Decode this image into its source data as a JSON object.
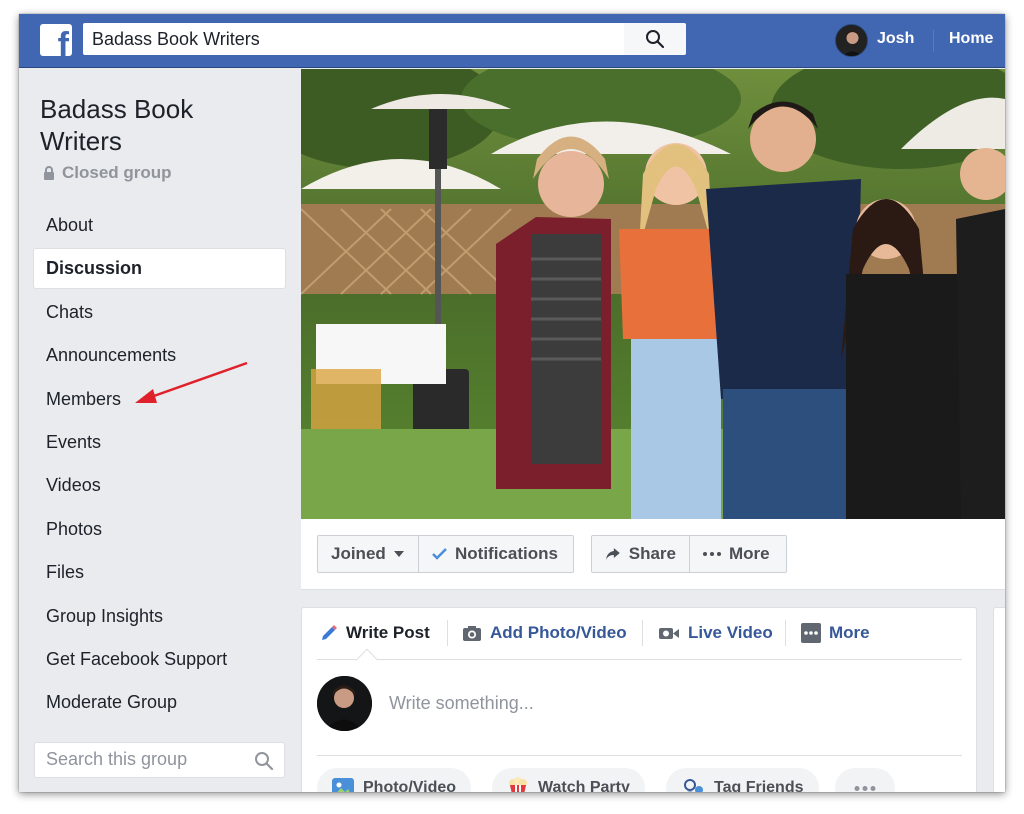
{
  "topbar": {
    "search_value": "Badass Book Writers",
    "user_name": "Josh",
    "home_label": "Home",
    "brand_color": "#4267b2"
  },
  "group": {
    "title_line1": "Badass Book",
    "title_line2": "Writers",
    "privacy": "Closed group"
  },
  "sidebar": {
    "items": [
      {
        "label": "About"
      },
      {
        "label": "Discussion",
        "active": true
      },
      {
        "label": "Chats"
      },
      {
        "label": "Announcements"
      },
      {
        "label": "Members"
      },
      {
        "label": "Events"
      },
      {
        "label": "Videos"
      },
      {
        "label": "Photos"
      },
      {
        "label": "Files"
      },
      {
        "label": "Group Insights"
      },
      {
        "label": "Get Facebook Support"
      },
      {
        "label": "Moderate Group"
      }
    ],
    "search_placeholder": "Search this group"
  },
  "actions": {
    "joined": "Joined",
    "notifications": "Notifications",
    "share": "Share",
    "more": "More"
  },
  "composer": {
    "tabs": [
      "Write Post",
      "Add Photo/Video",
      "Live Video",
      "More"
    ],
    "placeholder": "Write something...",
    "pills": [
      "Photo/Video",
      "Watch Party",
      "Tag Friends"
    ]
  },
  "annotation": {
    "color": "#e0202a"
  }
}
